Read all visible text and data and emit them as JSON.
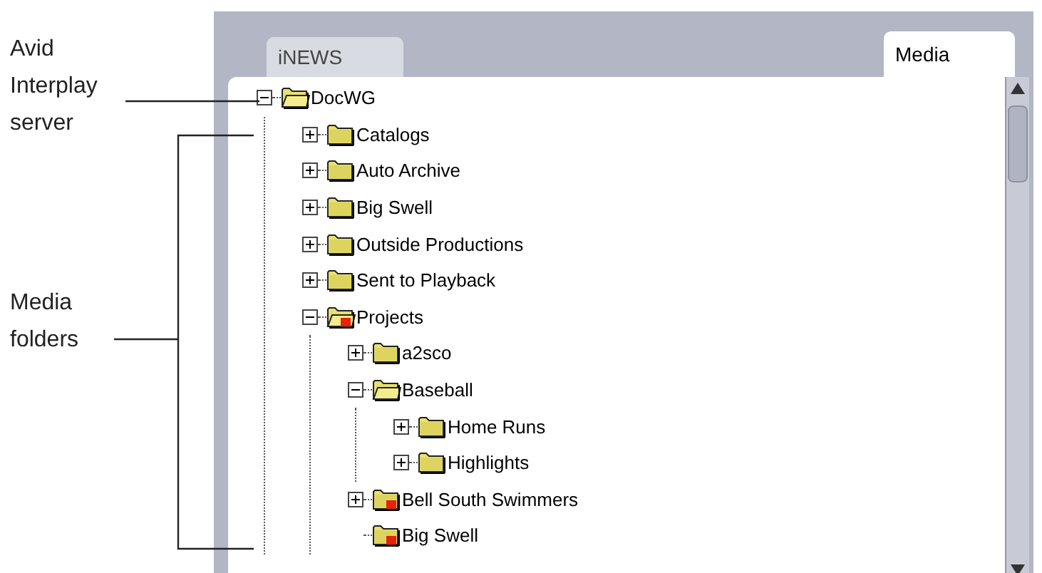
{
  "callouts": [
    {
      "text": "Avid Interplay server"
    },
    {
      "text": "Media folders"
    }
  ],
  "tabs": [
    {
      "label": "iNEWS",
      "selected": false
    },
    {
      "label": "Media",
      "selected": true
    }
  ],
  "tree": [
    {
      "label": "DocWG",
      "flagged": false,
      "expanded": true,
      "children": [
        {
          "label": "Catalogs",
          "flagged": false,
          "expanded": false
        },
        {
          "label": "Auto Archive",
          "flagged": false,
          "expanded": false
        },
        {
          "label": "Big Swell",
          "flagged": false,
          "expanded": false
        },
        {
          "label": "Outside Productions",
          "flagged": false,
          "expanded": false
        },
        {
          "label": "Sent to Playback",
          "flagged": false,
          "expanded": false
        },
        {
          "label": "Projects",
          "flagged": true,
          "expanded": true,
          "children": [
            {
              "label": "a2sco",
              "flagged": false,
              "expanded": false
            },
            {
              "label": "Baseball",
              "flagged": false,
              "expanded": true,
              "children": [
                {
                  "label": "Home Runs",
                  "flagged": false,
                  "expanded": false
                },
                {
                  "label": "Highlights",
                  "flagged": false,
                  "expanded": false
                }
              ]
            },
            {
              "label": "Bell South Swimmers",
              "flagged": true,
              "expanded": false
            },
            {
              "label": "Big Swell",
              "flagged": true
            }
          ]
        }
      ]
    }
  ]
}
